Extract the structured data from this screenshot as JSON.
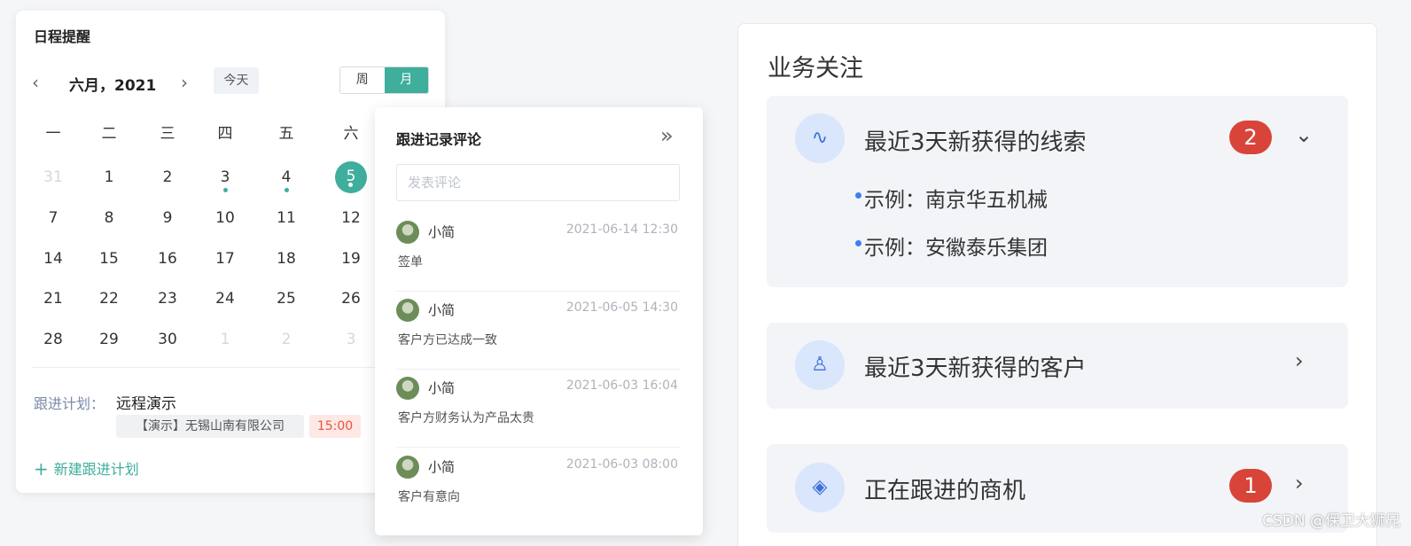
{
  "calendar": {
    "title": "日程提醒",
    "prev_icon": "‹",
    "next_icon": "›",
    "month": "六月，2021",
    "today_label": "今天",
    "view_week": "周",
    "view_month": "月",
    "weekdays": [
      "一",
      "二",
      "三",
      "四",
      "五",
      "六"
    ],
    "weeks": [
      [
        "31",
        "1",
        "2",
        "3",
        "4",
        "5"
      ],
      [
        "7",
        "8",
        "9",
        "10",
        "11",
        "12"
      ],
      [
        "14",
        "15",
        "16",
        "17",
        "18",
        "19"
      ],
      [
        "21",
        "22",
        "23",
        "24",
        "25",
        "26"
      ],
      [
        "28",
        "29",
        "30",
        "1",
        "2",
        "3"
      ]
    ],
    "plan_label": "跟进计划：",
    "plan_title": "远程演示",
    "plan_company": "【演示】无锡山南有限公司",
    "plan_time": "15:00",
    "new_plan_label": "新建跟进计划",
    "new_plan_icon": "+"
  },
  "comments": {
    "title": "跟进记录评论",
    "collapse_icon": "»",
    "input_placeholder": "发表评论",
    "items": [
      {
        "name": "小简",
        "time": "2021-06-14 12:30",
        "text": "签单"
      },
      {
        "name": "小简",
        "time": "2021-06-05 14:30",
        "text": "客户方已达成一致"
      },
      {
        "name": "小简",
        "time": "2021-06-03 16:04",
        "text": "客户方财务认为产品太贵"
      },
      {
        "name": "小简",
        "time": "2021-06-03 08:00",
        "text": "客户有意向"
      }
    ]
  },
  "business": {
    "title": "业务关注",
    "sections": [
      {
        "label": "最近3天新获得的线索",
        "badge": "2",
        "chevron": "⌄",
        "icon": "∿",
        "items": [
          "示例：南京华五机械",
          "示例：安徽泰乐集团"
        ]
      },
      {
        "label": "最近3天新获得的客户",
        "chevron": "›",
        "icon": "♙"
      },
      {
        "label": "正在跟进的商机",
        "badge": "1",
        "chevron": "›",
        "icon": "◈"
      }
    ]
  },
  "watermark": "CSDN @保卫大狮兄",
  "colors": {
    "accent": "#3fae9c",
    "badge": "#d9443a",
    "icon_bg": "#d9e6fb",
    "icon_fg": "#3e6fd8"
  }
}
